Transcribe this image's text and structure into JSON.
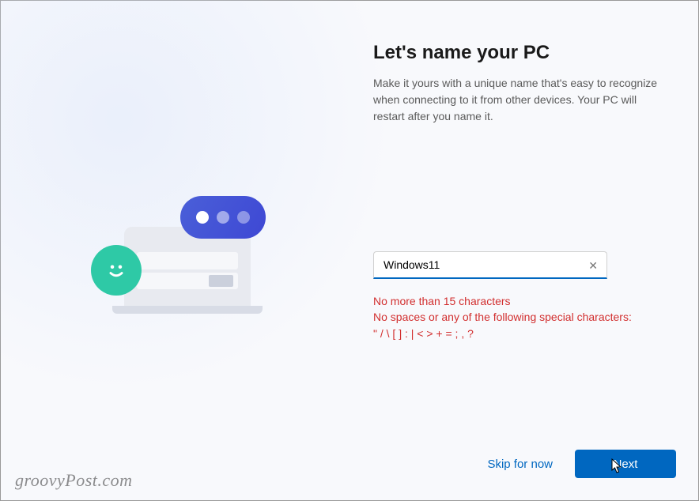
{
  "header": {
    "title": "Let's name your PC",
    "subtitle": "Make it yours with a unique name that's easy to recognize when connecting to it from other devices. Your PC will restart after you name it."
  },
  "form": {
    "pc_name_value": "Windows11",
    "clear_label": "✕"
  },
  "validation": {
    "line1": "No more than 15 characters",
    "line2": "No spaces or any of the following special characters:",
    "line3": "\" / \\ [ ] : | < > + = ; , ?"
  },
  "footer": {
    "skip_label": "Skip for now",
    "next_label": "Next"
  },
  "watermark": "groovyPost.com",
  "colors": {
    "accent": "#0067c0",
    "danger": "#d22f2f",
    "smiley": "#2ec9a6",
    "bubble": "#4654d6"
  }
}
